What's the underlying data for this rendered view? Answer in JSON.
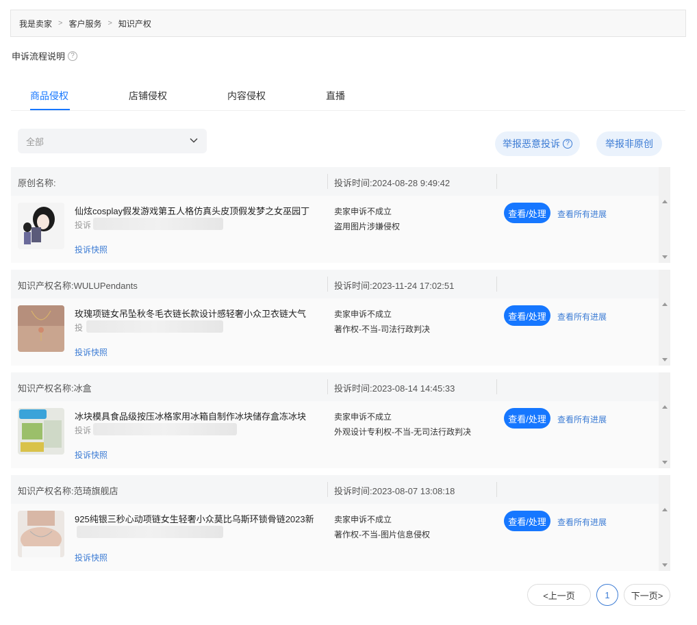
{
  "breadcrumb": [
    "我是卖家",
    "客户服务",
    "知识产权"
  ],
  "breadcrumb_sep": ">",
  "flow_help": "申诉流程说明",
  "tabs": [
    "商品侵权",
    "店铺侵权",
    "内容侵权",
    "直播"
  ],
  "active_tab": "商品侵权",
  "filter": {
    "value": "全部"
  },
  "actions": {
    "report_malicious": "举报恶意投诉",
    "report_non_original": "举报非原创"
  },
  "cards": [
    {
      "header_left": "原创名称:",
      "header_right": "投诉时间:2024-08-28 9:49:42",
      "title": "仙炫cosplay假发游戏第五人格仿真头皮顶假发梦之女巫园丁",
      "sub_prefix": "投诉",
      "snapshot_link": "投诉快照",
      "status": "卖家申诉不成立",
      "reason": "盗用图片涉嫌侵权",
      "view_button": "查看/处理",
      "progress_link": "查看所有进展"
    },
    {
      "header_left": "知识产权名称:WULUPendants",
      "header_right": "投诉时间:2023-11-24 17:02:51",
      "title": "玫瑰项链女吊坠秋冬毛衣链长款设计感轻奢小众卫衣链大气",
      "sub_prefix": "投",
      "snapshot_link": "投诉快照",
      "status": "卖家申诉不成立",
      "reason": "著作权-不当-司法行政判决",
      "view_button": "查看/处理",
      "progress_link": "查看所有进展"
    },
    {
      "header_left": "知识产权名称:冰盒",
      "header_right": "投诉时间:2023-08-14 14:45:33",
      "title": "冰块模具食品级按压冰格家用冰箱自制作冰块储存盒冻冰块",
      "sub_prefix": "投诉",
      "snapshot_link": "投诉快照",
      "status": "卖家申诉不成立",
      "reason": "外观设计专利权-不当-无司法行政判决",
      "view_button": "查看/处理",
      "progress_link": "查看所有进展"
    },
    {
      "header_left": "知识产权名称:范琦旗舰店",
      "header_right": "投诉时间:2023-08-07 13:08:18",
      "title": "925纯银三秒心动项链女生轻奢小众莫比乌斯环锁骨链2023新",
      "sub_prefix": "",
      "snapshot_link": "投诉快照",
      "status": "卖家申诉不成立",
      "reason": "著作权-不当-图片信息侵权",
      "view_button": "查看/处理",
      "progress_link": "查看所有进展"
    }
  ],
  "pagination": {
    "prev": "<上一页",
    "current": "1",
    "next": "下一页>"
  },
  "colors": {
    "primary": "#1677ff",
    "link": "#3b7bd4",
    "pill_bg": "#eaf2fc",
    "header_bg": "#f5f6f7"
  }
}
